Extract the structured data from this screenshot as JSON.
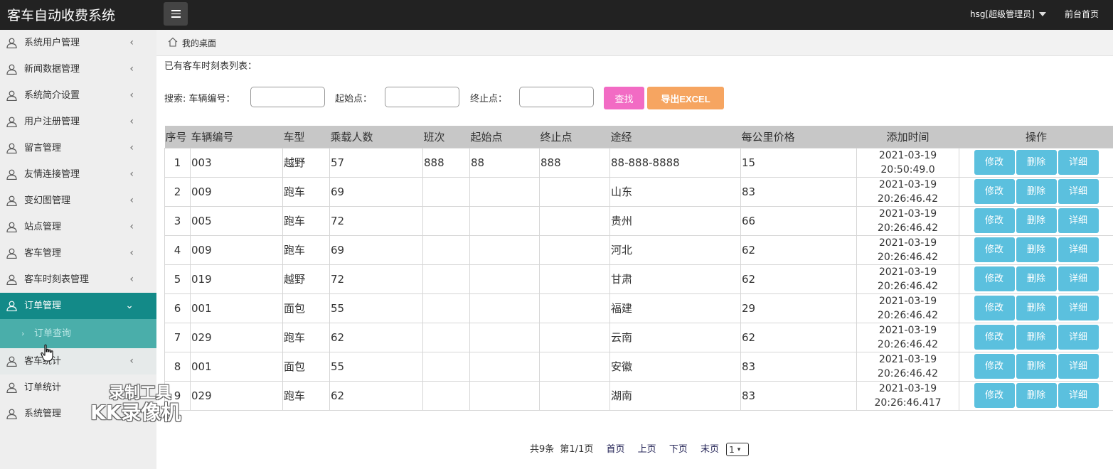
{
  "app": {
    "title": "客车自动收费系统",
    "user_menu": "hsg[超级管理员]",
    "front_link": "前台首页"
  },
  "sidebar": {
    "items": [
      {
        "label": "系统用户管理"
      },
      {
        "label": "新闻数据管理"
      },
      {
        "label": "系统简介设置"
      },
      {
        "label": "用户注册管理"
      },
      {
        "label": "留言管理"
      },
      {
        "label": "友情连接管理"
      },
      {
        "label": "变幻图管理"
      },
      {
        "label": "站点管理"
      },
      {
        "label": "客车管理"
      },
      {
        "label": "客车时刻表管理"
      },
      {
        "label": "订单管理"
      },
      {
        "label": "客车统计"
      },
      {
        "label": "订单统计"
      },
      {
        "label": "系统管理"
      }
    ],
    "sub_item": "订单查询",
    "chev_left": "‹",
    "chev_down": "⌄",
    "sub_chev": "›"
  },
  "breadcrumb": "我的桌面",
  "list_title": "已有客车时刻表列表：",
  "search": {
    "prefix": "搜索: 车辆编号：",
    "start_label": "起始点：",
    "end_label": "终止点：",
    "search_btn": "查找",
    "export_btn": "导出EXCEL"
  },
  "table": {
    "headers": [
      "序号",
      "车辆编号",
      "车型",
      "乘载人数",
      "班次",
      "起始点",
      "终止点",
      "途经",
      "每公里价格",
      "添加时间",
      "操作"
    ],
    "rows": [
      {
        "idx": "1",
        "no": "003",
        "type": "越野",
        "seats": "57",
        "shift": "888",
        "start": "88",
        "end": "888",
        "via": "88-888-8888",
        "price": "15",
        "date": "2021-03-19",
        "time": "20:50:49.0"
      },
      {
        "idx": "2",
        "no": "009",
        "type": "跑车",
        "seats": "69",
        "shift": "",
        "start": "",
        "end": "",
        "via": "山东",
        "price": "83",
        "date": "2021-03-19",
        "time": "20:26:46.42"
      },
      {
        "idx": "3",
        "no": "005",
        "type": "跑车",
        "seats": "72",
        "shift": "",
        "start": "",
        "end": "",
        "via": "贵州",
        "price": "66",
        "date": "2021-03-19",
        "time": "20:26:46.42"
      },
      {
        "idx": "4",
        "no": "009",
        "type": "跑车",
        "seats": "69",
        "shift": "",
        "start": "",
        "end": "",
        "via": "河北",
        "price": "62",
        "date": "2021-03-19",
        "time": "20:26:46.42"
      },
      {
        "idx": "5",
        "no": "019",
        "type": "越野",
        "seats": "72",
        "shift": "",
        "start": "",
        "end": "",
        "via": "甘肃",
        "price": "62",
        "date": "2021-03-19",
        "time": "20:26:46.42"
      },
      {
        "idx": "6",
        "no": "001",
        "type": "面包",
        "seats": "55",
        "shift": "",
        "start": "",
        "end": "",
        "via": "福建",
        "price": "29",
        "date": "2021-03-19",
        "time": "20:26:46.42"
      },
      {
        "idx": "7",
        "no": "029",
        "type": "跑车",
        "seats": "62",
        "shift": "",
        "start": "",
        "end": "",
        "via": "云南",
        "price": "62",
        "date": "2021-03-19",
        "time": "20:26:46.42"
      },
      {
        "idx": "8",
        "no": "001",
        "type": "面包",
        "seats": "55",
        "shift": "",
        "start": "",
        "end": "",
        "via": "安徽",
        "price": "83",
        "date": "2021-03-19",
        "time": "20:26:46.42"
      },
      {
        "idx": "9",
        "no": "029",
        "type": "跑车",
        "seats": "62",
        "shift": "",
        "start": "",
        "end": "",
        "via": "湖南",
        "price": "83",
        "date": "2021-03-19",
        "time": "20:26:46.417"
      }
    ],
    "actions": [
      "修改",
      "删除",
      "详细"
    ]
  },
  "pagination": {
    "total": "共9条",
    "page_info": "第1/1页",
    "first": "首页",
    "prev": "上页",
    "next": "下页",
    "last": "末页",
    "page_value": "1"
  },
  "watermark": {
    "line1": "录制工具",
    "line2": "KK录像机"
  },
  "colors": {
    "topbar": "#222222",
    "sidebar_active": "#138a88",
    "sidebar_sub": "#4aaeaa",
    "search_button": "#f26bc4",
    "export_button": "#f6a561",
    "action_button": "#5bc0de"
  }
}
